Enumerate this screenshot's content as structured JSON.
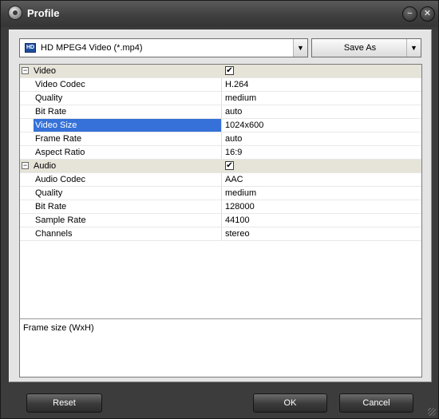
{
  "window": {
    "title": "Profile",
    "minimize_glyph": "−",
    "close_glyph": "✕"
  },
  "profile_combo": {
    "icon_text": "HD",
    "value": "HD MPEG4 Video (*.mp4)"
  },
  "save_as": {
    "label": "Save As"
  },
  "arrow_glyph": "▼",
  "properties": {
    "groups": [
      {
        "name": "Video",
        "expander": "−",
        "checked": "✔",
        "rows": [
          {
            "name": "Video Codec",
            "value": "H.264"
          },
          {
            "name": "Quality",
            "value": "medium"
          },
          {
            "name": "Bit Rate",
            "value": "auto"
          },
          {
            "name": "Video Size",
            "value": "1024x600"
          },
          {
            "name": "Frame Rate",
            "value": "auto"
          },
          {
            "name": "Aspect Ratio",
            "value": "16:9"
          }
        ]
      },
      {
        "name": "Audio",
        "expander": "−",
        "checked": "✔",
        "rows": [
          {
            "name": "Audio Codec",
            "value": "AAC"
          },
          {
            "name": "Quality",
            "value": "medium"
          },
          {
            "name": "Bit Rate",
            "value": "128000"
          },
          {
            "name": "Sample Rate",
            "value": "44100"
          },
          {
            "name": "Channels",
            "value": "stereo"
          }
        ]
      }
    ],
    "selected_row": "Video Size"
  },
  "description": "Frame size (WxH)",
  "buttons": {
    "reset": "Reset",
    "ok": "OK",
    "cancel": "Cancel"
  },
  "colors": {
    "selection": "#3571d8",
    "group_row": "#e6e3d8",
    "chrome": "#3c3c3c"
  }
}
